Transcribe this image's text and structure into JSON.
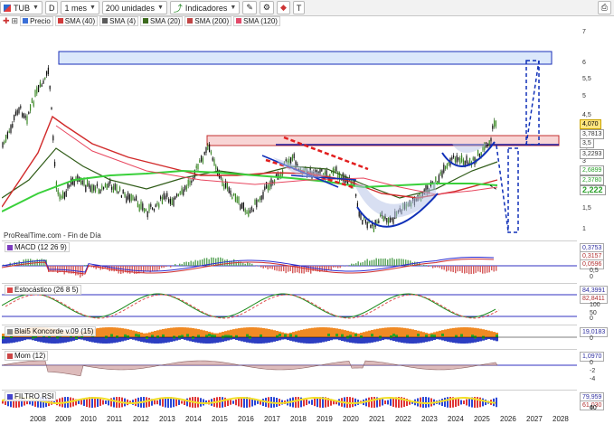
{
  "toolbar": {
    "ticker": "TUB",
    "period_letter": "D",
    "timeframe": "1 mes",
    "units": "200 unidades",
    "indicators_label": "Indicadores"
  },
  "legend": [
    {
      "label": "Precio",
      "color": "#3a6fd8"
    },
    {
      "label": "SMA (40)",
      "color": "#d23b3b"
    },
    {
      "label": "SMA (4)",
      "color": "#5a5a5a"
    },
    {
      "label": "SMA (20)",
      "color": "#3d6b1e"
    },
    {
      "label": "SMA (200)",
      "color": "#c24545"
    },
    {
      "label": "SMA (120)",
      "color": "#e24a6a"
    }
  ],
  "main_chart": {
    "watermark": "ProRealTime.com - Fin de Día",
    "y_ticks": [
      "7",
      "6",
      "5,5",
      "5",
      "4,5",
      "4",
      "3,5",
      "3",
      "2,5",
      "2",
      "1,5",
      "1"
    ],
    "price_tags": [
      {
        "text": "4,070",
        "bg": "#ffe680",
        "fg": "#000"
      },
      {
        "text": "3,7813",
        "bg": "#ffffff",
        "fg": "#333"
      },
      {
        "text": "3,5",
        "bg": "#ffffff",
        "fg": "#333"
      },
      {
        "text": "3,2293",
        "bg": "#ffffff",
        "fg": "#333"
      },
      {
        "text": "2,6899",
        "bg": "#ffffff",
        "fg": "#2aa02a"
      },
      {
        "text": "2,3780",
        "bg": "#ffffff",
        "fg": "#2aa02a"
      },
      {
        "text": "2,222",
        "bg": "#ffffff",
        "fg": "#2aa02a"
      }
    ]
  },
  "indicators": [
    {
      "name": "MACD (12 26 9)",
      "tags": [
        "0,3753",
        "0,3157",
        "0,0596"
      ],
      "ticks": [
        "0,5",
        "0"
      ]
    },
    {
      "name": "Estocástico (26 8 5)",
      "tags": [
        "84,3991",
        "82,8411"
      ],
      "ticks": [
        "100",
        "50",
        "0"
      ]
    },
    {
      "name": "Blai5 Koncorde v.09 (15)",
      "tags": [
        "19,0183"
      ],
      "ticks": [
        "0"
      ]
    },
    {
      "name": "Mom (12)",
      "tags": [
        "1,0970"
      ],
      "ticks": [
        "0",
        "-2",
        "-4"
      ]
    },
    {
      "name": "FILTRO RSI",
      "tags": [
        "79,959",
        "61,030"
      ],
      "ticks": [
        "60",
        "40"
      ]
    }
  ],
  "x_axis": [
    "2008",
    "2009",
    "2010",
    "2011",
    "2012",
    "2013",
    "2014",
    "2015",
    "2016",
    "2017",
    "2018",
    "2019",
    "2020",
    "2021",
    "2022",
    "2023",
    "2024",
    "2025",
    "2026",
    "2027",
    "2028"
  ]
}
